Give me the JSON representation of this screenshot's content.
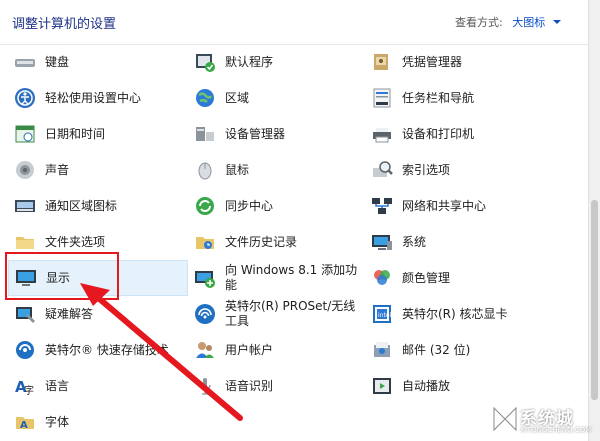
{
  "header": {
    "title": "调整计算机的设置",
    "view_by_label": "查看方式:",
    "view_by_value": "大图标"
  },
  "columns": [
    [
      {
        "label": "键盘",
        "icon": "keyboard-icon"
      },
      {
        "label": "轻松使用设置中心",
        "icon": "ease-of-access-icon"
      },
      {
        "label": "日期和时间",
        "icon": "date-time-icon"
      },
      {
        "label": "声音",
        "icon": "sound-icon"
      },
      {
        "label": "通知区域图标",
        "icon": "notification-area-icon"
      },
      {
        "label": "文件夹选项",
        "icon": "folder-options-icon"
      },
      {
        "label": "显示",
        "icon": "display-icon",
        "selected": true
      },
      {
        "label": "疑难解答",
        "icon": "troubleshooting-icon"
      },
      {
        "label": "英特尔® 快速存储技术",
        "icon": "intel-rst-icon"
      },
      {
        "label": "语言",
        "icon": "language-icon"
      },
      {
        "label": "字体",
        "icon": "fonts-icon"
      }
    ],
    [
      {
        "label": "默认程序",
        "icon": "default-programs-icon"
      },
      {
        "label": "区域",
        "icon": "region-icon"
      },
      {
        "label": "设备管理器",
        "icon": "device-manager-icon"
      },
      {
        "label": "鼠标",
        "icon": "mouse-icon"
      },
      {
        "label": "同步中心",
        "icon": "sync-center-icon"
      },
      {
        "label": "文件历史记录",
        "icon": "file-history-icon"
      },
      {
        "label": "向 Windows 8.1 添加功能",
        "icon": "add-features-icon"
      },
      {
        "label": "英特尔(R) PROSet/无线工具",
        "icon": "intel-proset-icon"
      },
      {
        "label": "用户帐户",
        "icon": "user-accounts-icon"
      },
      {
        "label": "语音识别",
        "icon": "speech-recognition-icon"
      }
    ],
    [
      {
        "label": "凭据管理器",
        "icon": "credential-manager-icon"
      },
      {
        "label": "任务栏和导航",
        "icon": "taskbar-icon"
      },
      {
        "label": "设备和打印机",
        "icon": "devices-printers-icon"
      },
      {
        "label": "索引选项",
        "icon": "indexing-options-icon"
      },
      {
        "label": "网络和共享中心",
        "icon": "network-sharing-icon"
      },
      {
        "label": "系统",
        "icon": "system-icon"
      },
      {
        "label": "颜色管理",
        "icon": "color-management-icon"
      },
      {
        "label": "英特尔(R) 核芯显卡",
        "icon": "intel-graphics-icon"
      },
      {
        "label": "邮件 (32 位)",
        "icon": "mail-icon"
      },
      {
        "label": "自动播放",
        "icon": "autoplay-icon"
      }
    ]
  ],
  "watermark": {
    "text": "系统城",
    "sub": "XITONGCHENG.COM"
  },
  "colors": {
    "title": "#1e3287",
    "link": "#0a4fc7",
    "highlight": "#e4181e",
    "selected_bg": "#e5f1fb"
  }
}
